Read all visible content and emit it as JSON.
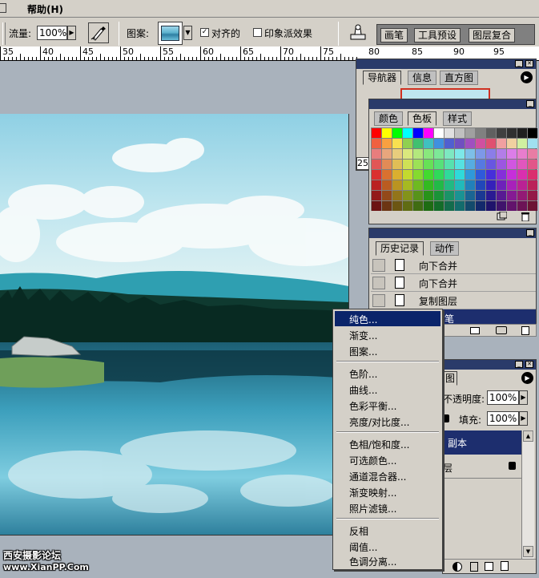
{
  "menubar": {
    "help_label": "帮助",
    "help_key": "(H)"
  },
  "options": {
    "flow_label": "流量:",
    "flow_value": "100%",
    "pattern_label": "图案:",
    "aligned_label": "对齐的",
    "impressionist_label": "印象派效果",
    "aligned_checked": true,
    "impressionist_checked": false
  },
  "palette_well": {
    "tabs": [
      "画笔",
      "工具预设",
      "图层复合"
    ]
  },
  "ruler": {
    "labels": [
      "35",
      "40",
      "45",
      "50",
      "55",
      "60",
      "65",
      "70",
      "75",
      "80",
      "85",
      "90",
      "95"
    ]
  },
  "navigator_panel": {
    "tabs": [
      "导航器",
      "信息",
      "直方图"
    ],
    "zoom_value": "25"
  },
  "swatches_panel": {
    "tabs": [
      "颜色",
      "色板",
      "样式"
    ]
  },
  "history_panel": {
    "tabs": [
      "历史记录",
      "动作"
    ],
    "items": [
      "向下合并",
      "向下合并",
      "复制图层"
    ],
    "selected_fragment": "笔"
  },
  "layers_panel": {
    "tab_fragment": "图",
    "opacity_label": "不透明度:",
    "opacity_value": "100%",
    "fill_label": "填充:",
    "fill_value": "100%",
    "layer_name_fragment": "副本",
    "layer2_fragment": "层"
  },
  "context_menu": {
    "selected_index": 0,
    "groups": [
      [
        "纯色...",
        "渐变...",
        "图案..."
      ],
      [
        "色阶...",
        "曲线...",
        "色彩平衡...",
        "亮度/对比度..."
      ],
      [
        "色相/饱和度...",
        "可选颜色...",
        "通道混合器...",
        "渐变映射...",
        "照片滤镜..."
      ],
      [
        "反相",
        "阈值...",
        "色调分离..."
      ]
    ]
  },
  "watermark": {
    "line1": "西安摄影论坛",
    "line2": "www.XianPP.Com"
  },
  "colors": {
    "title_bar": "#2a3b6a",
    "highlight": "#0a246a",
    "panel_bg": "#d4d0c8",
    "workspace": "#a9b2bc"
  }
}
